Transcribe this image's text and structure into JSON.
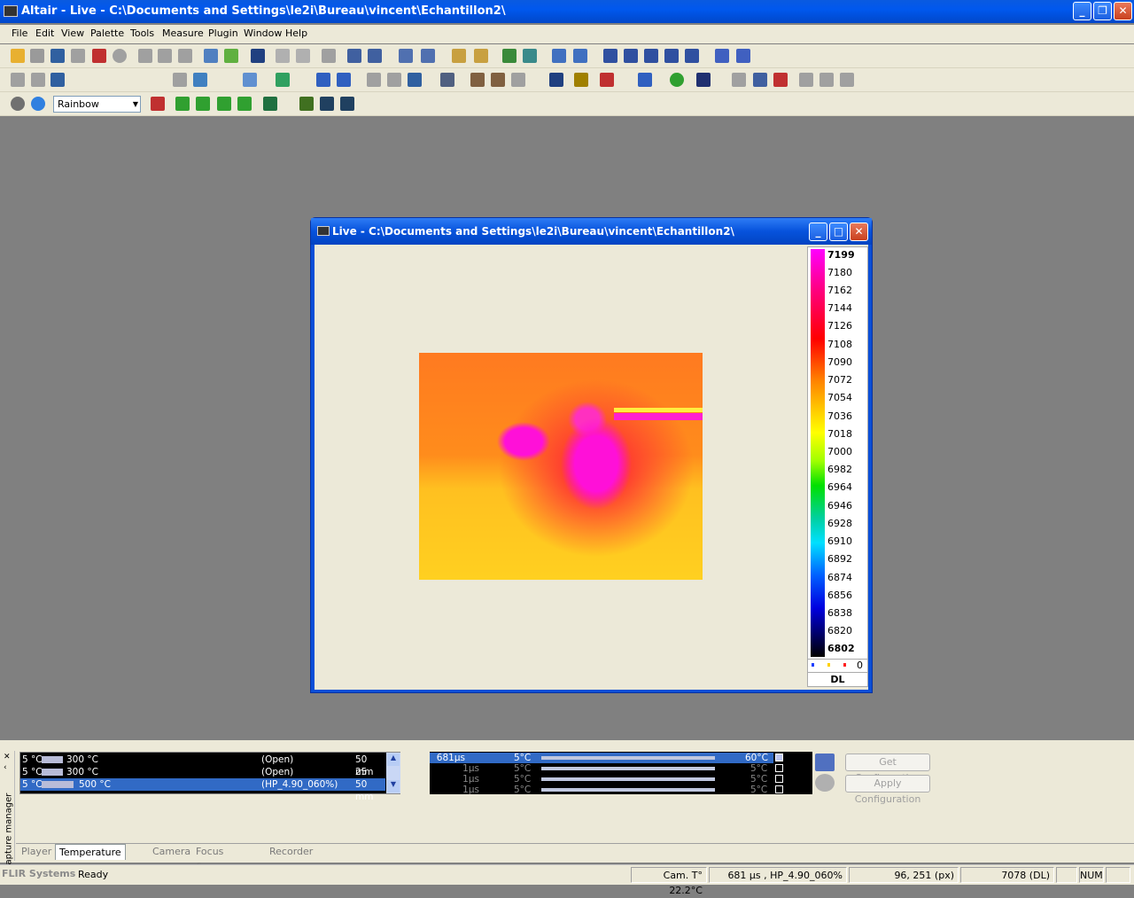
{
  "app": {
    "title": "Altair - Live - C:\\Documents and Settings\\le2i\\Bureau\\vincent\\Echantillon2\\"
  },
  "menu": [
    "File",
    "Edit",
    "View",
    "Palette",
    "Tools",
    "Measure",
    "Plugin",
    "Window",
    "Help"
  ],
  "toolbar": {
    "palette_value": "Rainbow"
  },
  "live_window": {
    "title": "Live - C:\\Documents and Settings\\le2i\\Bureau\\vincent\\Echantillon2\\",
    "colorbar": {
      "max": "7199",
      "min": "6802",
      "ticks": [
        "7180",
        "7162",
        "7144",
        "7126",
        "7108",
        "7090",
        "7072",
        "7054",
        "7036",
        "7018",
        "7000",
        "6982",
        "6964",
        "6946",
        "6928",
        "6910",
        "6892",
        "6874",
        "6856",
        "6838",
        "6820"
      ],
      "count": "0",
      "unit": "DL"
    }
  },
  "lens_table": [
    {
      "min": "5 °C",
      "max": "300 °C",
      "filter": "(Open)",
      "focal": "50 mm"
    },
    {
      "min": "5 °C",
      "max": "300 °C",
      "filter": "(Open)",
      "focal": "25 mm"
    },
    {
      "min": "5 °C",
      "max": "500 °C",
      "filter": "(HP_4.90_060%)",
      "focal": "50 mm"
    }
  ],
  "integration_table": [
    {
      "time": "681µs",
      "tmin": "5°C",
      "tmax": "60°C"
    },
    {
      "time": "1µs",
      "tmin": "5°C",
      "tmax": "5°C"
    },
    {
      "time": "1µs",
      "tmin": "5°C",
      "tmax": "5°C"
    },
    {
      "time": "1µs",
      "tmin": "5°C",
      "tmax": "5°C"
    }
  ],
  "buttons": {
    "get_config": "Get Configuration",
    "apply_config": "Apply Configuration"
  },
  "side_tab": "Capture manager",
  "tabs": [
    "Player",
    "Temperature range",
    "Camera",
    "Focus & Wheel",
    "Recorder"
  ],
  "status": {
    "brand": "FLIR Systems",
    "ready": "Ready",
    "cam_temp": "Cam. T° 22.2°C",
    "integration": "681 µs , HP_4.90_060%",
    "position": "96, 251 (px)",
    "value": "7078 (DL)",
    "num": "NUM"
  }
}
